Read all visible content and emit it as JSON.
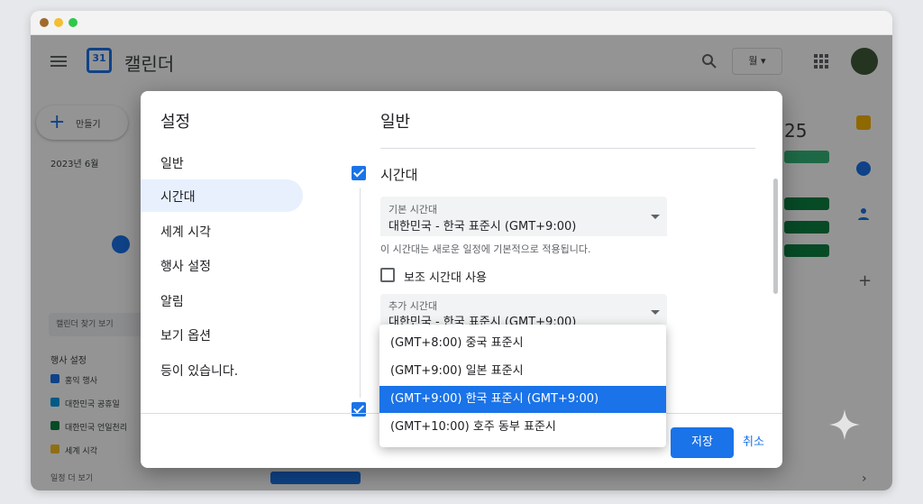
{
  "app": {
    "title": "캘린더",
    "logo_number": "31",
    "view_label": "월",
    "header_date": "25",
    "create_label": "만들기",
    "mini_month": "2023년 6월",
    "search_people_placeholder": "캘린더 찾기 보기",
    "calendars_heading": "행사 설정",
    "calendar_items": [
      "홍익 행사",
      "대한민국 공휴일",
      "대한민국 언일천리",
      "세계 시각"
    ],
    "more_label": "일정 더 보기"
  },
  "settings": {
    "title": "설정",
    "nav": [
      "일반",
      "시간대",
      "세계 시각",
      "행사 설정",
      "알림",
      "보기 옵션",
      "등이 있습니다."
    ],
    "section_title": "일반",
    "timezone_heading": "시간대",
    "primary_label": "기본 시간대",
    "primary_value": "대한민국 - 한국 표준시 (GMT+9:00)",
    "help_text": "이 시간대는 새로운 일정에 기본적으로 적용됩니다.",
    "secondary_checkbox_label": "보조 시간대 사용",
    "extra_label": "추가 시간대",
    "extra_value": "대한민국 - 한국 표준시 (GMT+9:00)",
    "options": [
      "(GMT+8:00) 중국 표준시",
      "(GMT+9:00) 일본 표준시",
      "(GMT+9:00) 한국 표준시 (GMT+9:00)",
      "(GMT+10:00) 호주 동부 표준시"
    ],
    "save_label": "저장",
    "cancel_label": "취소"
  },
  "colors": {
    "accent": "#1a73e8",
    "selected_nav_bg": "#e8f0fe"
  }
}
